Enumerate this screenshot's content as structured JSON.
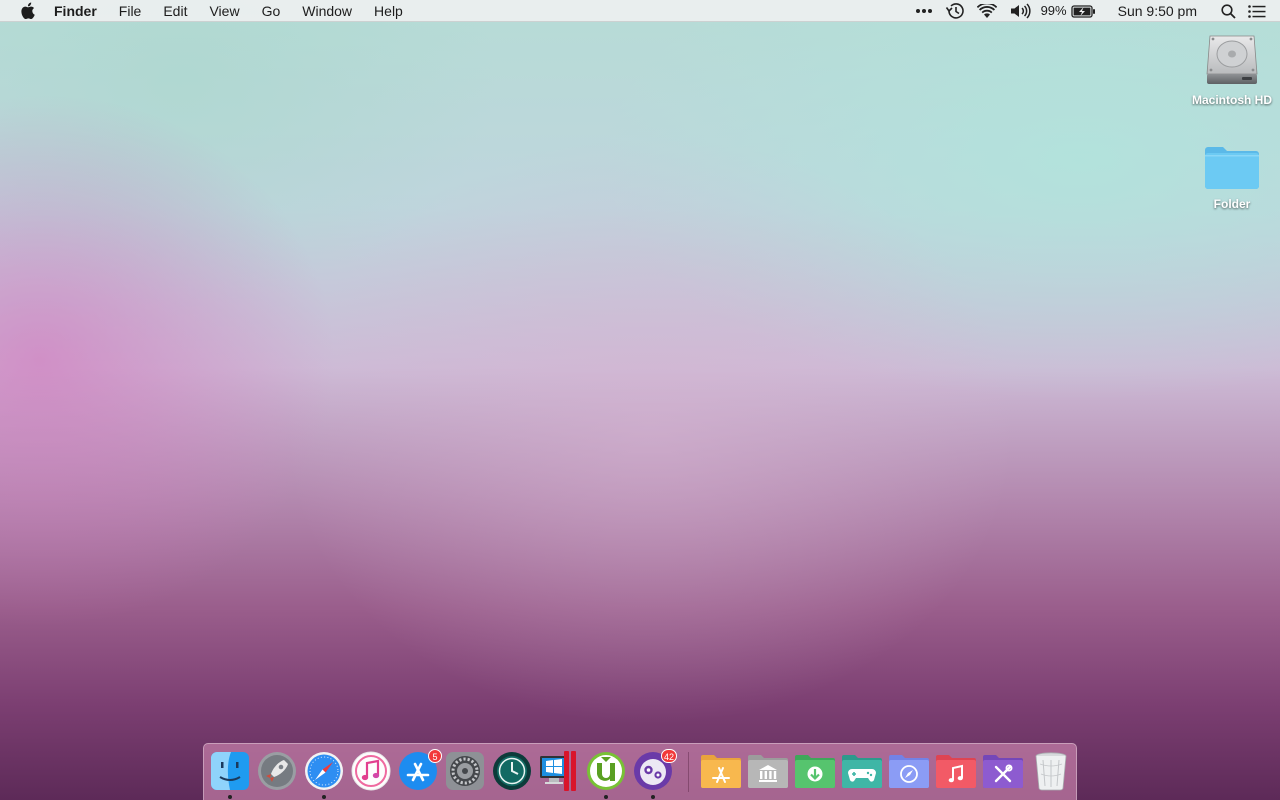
{
  "menubar": {
    "app_name": "Finder",
    "menus": [
      "File",
      "Edit",
      "View",
      "Go",
      "Window",
      "Help"
    ],
    "battery_percent": "99%",
    "clock": "Sun 9:50 pm",
    "status_icons": [
      "more-icon",
      "time-machine-icon",
      "wifi-icon",
      "volume-icon",
      "battery-charging-icon",
      "spotlight-icon",
      "notification-center-icon"
    ]
  },
  "desktop": {
    "icons": [
      {
        "label": "Macintosh HD",
        "icon": "hard-drive-icon"
      },
      {
        "label": "Folder",
        "icon": "folder-icon"
      }
    ]
  },
  "dock": {
    "apps": [
      {
        "name": "finder",
        "running": true
      },
      {
        "name": "launchpad",
        "running": false
      },
      {
        "name": "safari",
        "running": true
      },
      {
        "name": "itunes",
        "running": false
      },
      {
        "name": "app-store",
        "running": false,
        "badge": "5"
      },
      {
        "name": "system-preferences",
        "running": false
      },
      {
        "name": "time-machine",
        "running": false
      },
      {
        "name": "parallels-desktop",
        "running": false
      },
      {
        "name": "utorrent",
        "running": true
      },
      {
        "name": "tweetbot",
        "running": true,
        "badge": "42"
      }
    ],
    "stacks": [
      "applications",
      "library",
      "downloads",
      "games",
      "safari",
      "music",
      "utilities"
    ],
    "trash": "trash"
  },
  "colors": {
    "folder_blue": "#6ccaf3",
    "badge_red": "#f2383a",
    "stack_orange": "#f8b84e",
    "stack_gray": "#b7b7b7",
    "stack_green": "#56c46e",
    "stack_teal": "#3fb6a6",
    "stack_periwinkle": "#8b9cf5",
    "stack_red": "#f25a66",
    "stack_purple": "#8d5bd0"
  }
}
